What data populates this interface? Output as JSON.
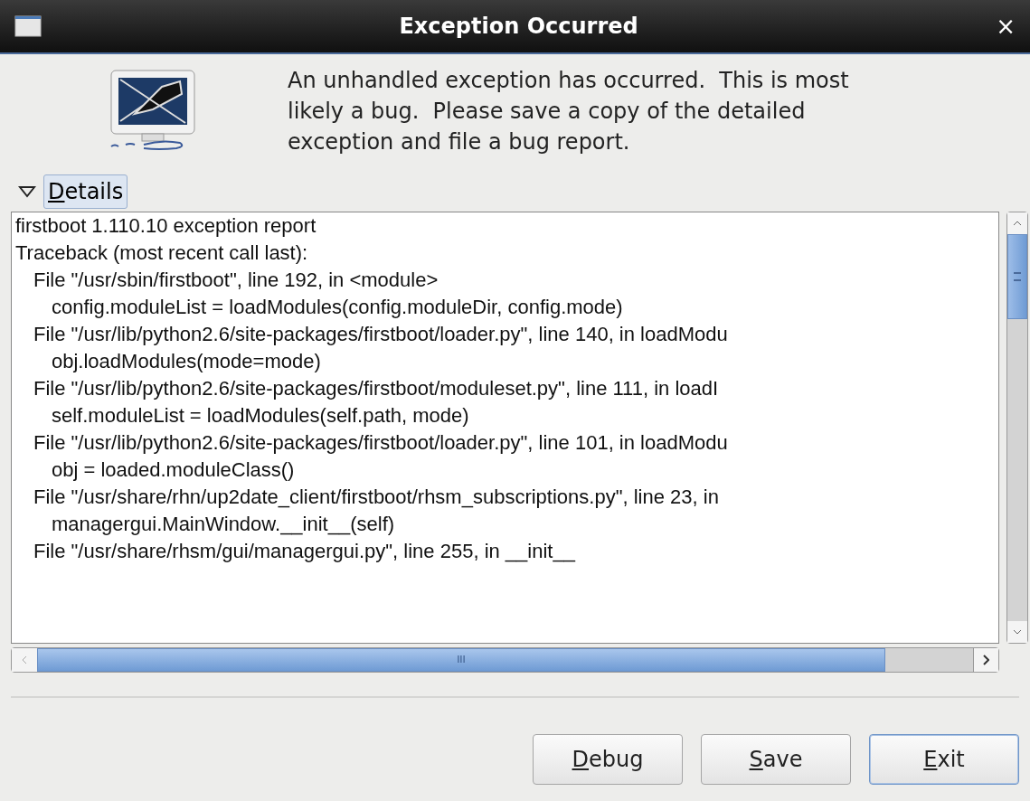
{
  "window": {
    "title": "Exception Occurred",
    "close": "×"
  },
  "message": "An unhandled exception has occurred.  This is most likely a bug.  Please save a copy of the detailed exception and file a bug report.",
  "details": {
    "label": "Details",
    "expanded": true
  },
  "report_lines": [
    {
      "kind": "header",
      "text": "firstboot 1.110.10 exception report"
    },
    {
      "kind": "header",
      "text": "Traceback (most recent call last):"
    },
    {
      "kind": "file",
      "text": "File \"/usr/sbin/firstboot\", line 192, in <module>"
    },
    {
      "kind": "code",
      "text": "config.moduleList = loadModules(config.moduleDir, config.mode)"
    },
    {
      "kind": "file",
      "text": "File \"/usr/lib/python2.6/site-packages/firstboot/loader.py\", line 140, in loadModu"
    },
    {
      "kind": "code",
      "text": "obj.loadModules(mode=mode)"
    },
    {
      "kind": "file",
      "text": "File \"/usr/lib/python2.6/site-packages/firstboot/moduleset.py\", line 111, in loadI"
    },
    {
      "kind": "code",
      "text": "self.moduleList = loadModules(self.path, mode)"
    },
    {
      "kind": "file",
      "text": "File \"/usr/lib/python2.6/site-packages/firstboot/loader.py\", line 101, in loadModu"
    },
    {
      "kind": "code",
      "text": "obj = loaded.moduleClass()"
    },
    {
      "kind": "file",
      "text": "File \"/usr/share/rhn/up2date_client/firstboot/rhsm_subscriptions.py\", line 23, in"
    },
    {
      "kind": "code",
      "text": "managergui.MainWindow.__init__(self)"
    },
    {
      "kind": "file",
      "text": "File \"/usr/share/rhsm/gui/managergui.py\", line 255, in __init__"
    }
  ],
  "scrollbar_thumb_glyph": "III",
  "buttons": [
    {
      "label": "Debug",
      "focused": false
    },
    {
      "label": "Save",
      "focused": false
    },
    {
      "label": "Exit",
      "focused": true
    }
  ]
}
